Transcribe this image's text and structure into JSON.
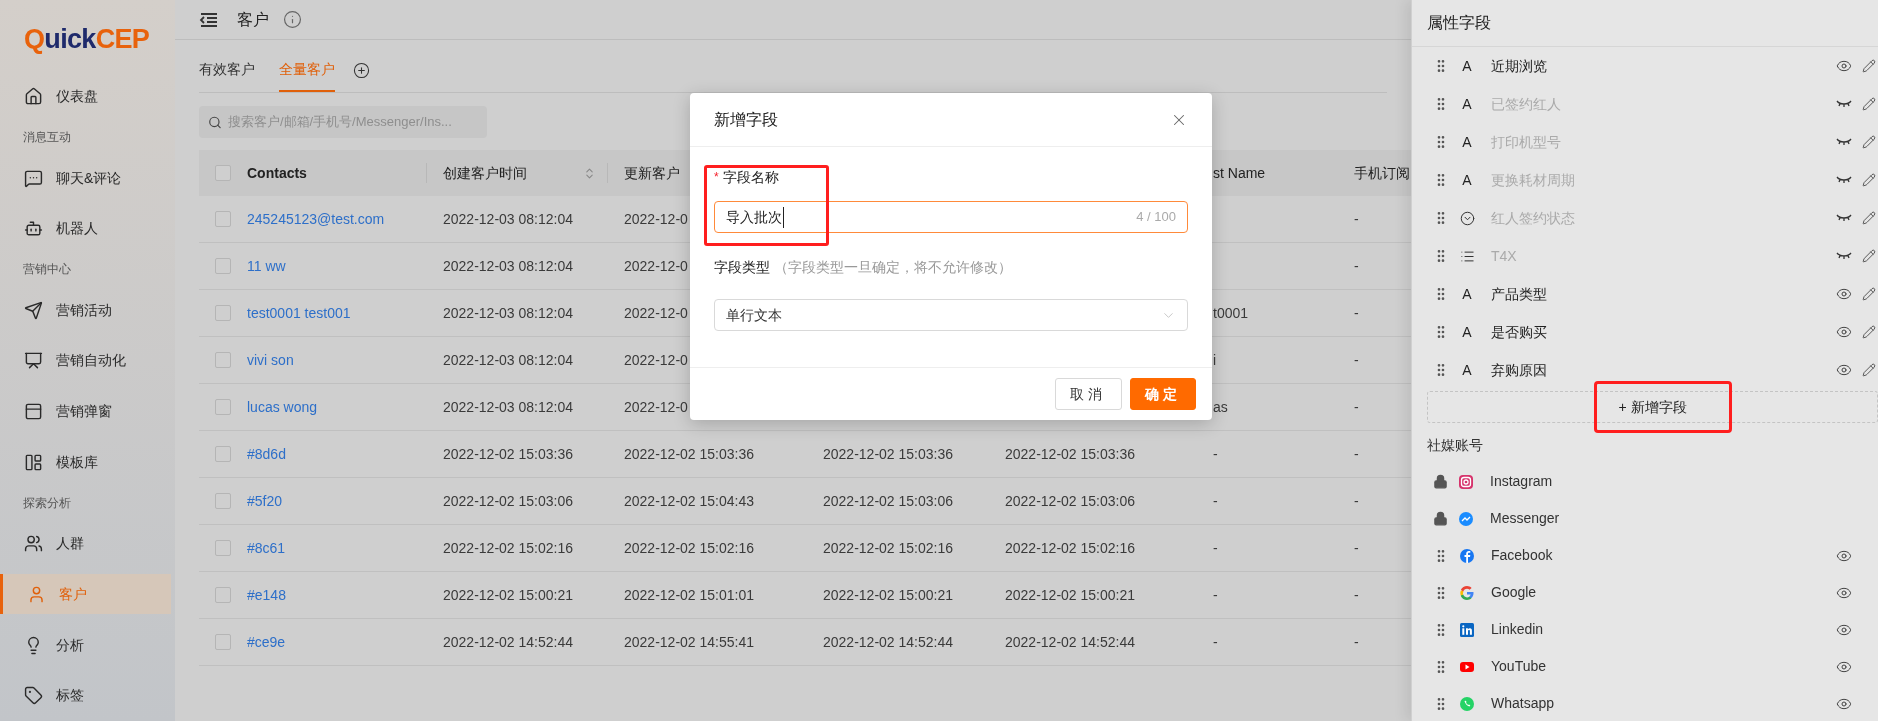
{
  "sidebar": {
    "logo": [
      {
        "text": "Q",
        "color": "#e8620c"
      },
      {
        "text": "uick",
        "color": "#1f2a6b"
      },
      {
        "text": "CEP",
        "color": "#e8620c"
      }
    ],
    "items": [
      {
        "kind": "item",
        "label": "仪表盘",
        "selected": false
      },
      {
        "kind": "section",
        "label": "消息互动"
      },
      {
        "kind": "item",
        "label": "聊天&评论",
        "selected": false
      },
      {
        "kind": "item",
        "label": "机器人",
        "selected": false
      },
      {
        "kind": "section",
        "label": "营销中心"
      },
      {
        "kind": "item",
        "label": "营销活动",
        "selected": false
      },
      {
        "kind": "item",
        "label": "营销自动化",
        "selected": false
      },
      {
        "kind": "item",
        "label": "营销弹窗",
        "selected": false
      },
      {
        "kind": "item",
        "label": "模板库",
        "selected": false
      },
      {
        "kind": "section",
        "label": "探索分析"
      },
      {
        "kind": "item",
        "label": "人群",
        "selected": false
      },
      {
        "kind": "item",
        "label": "客户",
        "selected": true
      },
      {
        "kind": "item",
        "label": "分析",
        "selected": false
      },
      {
        "kind": "item",
        "label": "标签",
        "selected": false
      }
    ]
  },
  "header": {
    "title": "客户"
  },
  "tabs": [
    {
      "label": "有效客户",
      "selected": false
    },
    {
      "label": "全量客户",
      "selected": true
    }
  ],
  "search": {
    "placeholder": "搜索客户/邮箱/手机号/Messenger/Ins..."
  },
  "table": {
    "header_checked": false,
    "columns": [
      {
        "label": "Contacts",
        "sortable": false
      },
      {
        "label": "创建客户时间",
        "sortable": true
      },
      {
        "label": "更新客户"
      },
      {},
      {},
      {
        "label": "st Name",
        "sortable": false
      },
      {
        "label": "手机订阅",
        "sortable": false
      }
    ],
    "rows": [
      {
        "checked": false,
        "cells": [
          "245245123@test.com",
          "2022-12-03 08:12:04",
          "2022-12-0",
          null,
          null,
          null,
          "-"
        ]
      },
      {
        "checked": false,
        "cells": [
          "11 ww",
          "2022-12-03 08:12:04",
          "2022-12-0",
          null,
          null,
          null,
          "-"
        ]
      },
      {
        "checked": false,
        "cells": [
          "test0001 test001",
          "2022-12-03 08:12:04",
          "2022-12-0",
          null,
          null,
          "t0001",
          "-"
        ]
      },
      {
        "checked": false,
        "cells": [
          "vivi son",
          "2022-12-03 08:12:04",
          "2022-12-0",
          null,
          null,
          "i",
          "-"
        ]
      },
      {
        "checked": false,
        "cells": [
          "lucas wong",
          "2022-12-03 08:12:04",
          "2022-12-0",
          null,
          null,
          "as",
          "-"
        ]
      },
      {
        "checked": false,
        "cells": [
          "#8d6d",
          "2022-12-02 15:03:36",
          "2022-12-02 15:03:36",
          "2022-12-02 15:03:36",
          "2022-12-02 15:03:36",
          "-",
          "-"
        ]
      },
      {
        "checked": false,
        "cells": [
          "#5f20",
          "2022-12-02 15:03:06",
          "2022-12-02 15:04:43",
          "2022-12-02 15:03:06",
          "2022-12-02 15:03:06",
          "-",
          "-"
        ]
      },
      {
        "checked": false,
        "cells": [
          "#8c61",
          "2022-12-02 15:02:16",
          "2022-12-02 15:02:16",
          "2022-12-02 15:02:16",
          "2022-12-02 15:02:16",
          "-",
          "-"
        ]
      },
      {
        "checked": false,
        "cells": [
          "#e148",
          "2022-12-02 15:00:21",
          "2022-12-02 15:01:01",
          "2022-12-02 15:00:21",
          "2022-12-02 15:00:21",
          "-",
          "-"
        ]
      },
      {
        "checked": false,
        "cells": [
          "#ce9e",
          "2022-12-02 14:52:44",
          "2022-12-02 14:55:41",
          "2022-12-02 14:52:44",
          "2022-12-02 14:52:44",
          "-",
          "-"
        ]
      }
    ]
  },
  "modal": {
    "title": "新增字段",
    "fields": [
      {
        "kind": "input",
        "required_mark": "*",
        "label": "字段名称",
        "value": "导入批次",
        "counter": "4 / 100",
        "focused": true
      },
      {
        "kind": "select",
        "label": "字段类型",
        "hint": "（字段类型一旦确定，将不允许修改）",
        "value": "单行文本",
        "focused": false
      }
    ],
    "buttons": [
      {
        "kind": "default",
        "label": "取消"
      },
      {
        "kind": "primary",
        "label": "确定"
      }
    ]
  },
  "panel": {
    "title": "属性字段",
    "fields": [
      {
        "kind": "text",
        "glyph": "A",
        "label": "近期浏览",
        "visible": true
      },
      {
        "kind": "text",
        "glyph": "A",
        "label": "已签约红人",
        "visible": false
      },
      {
        "kind": "text",
        "glyph": "A",
        "label": "打印机型号",
        "visible": false
      },
      {
        "kind": "text",
        "glyph": "A",
        "label": "更换耗材周期",
        "visible": false
      },
      {
        "kind": "select",
        "label": "红人签约状态",
        "visible": false
      },
      {
        "kind": "list",
        "label": "T4X",
        "visible": false
      },
      {
        "kind": "text",
        "glyph": "A",
        "label": "产品类型",
        "visible": true
      },
      {
        "kind": "text",
        "glyph": "A",
        "label": "是否购买",
        "visible": true
      },
      {
        "kind": "text",
        "glyph": "A",
        "label": "弃购原因",
        "visible": true
      }
    ],
    "add_button": "+ 新增字段",
    "section": "社媒账号",
    "social": [
      {
        "label": "Instagram",
        "locked": true
      },
      {
        "label": "Messenger",
        "locked": true
      },
      {
        "label": "Facebook",
        "locked": false,
        "visible": true
      },
      {
        "label": "Google",
        "locked": false,
        "visible": true
      },
      {
        "label": "Linkedin",
        "locked": false,
        "visible": true
      },
      {
        "label": "YouTube",
        "locked": false,
        "visible": true
      },
      {
        "label": "Whatsapp",
        "locked": false,
        "visible": true
      }
    ]
  }
}
